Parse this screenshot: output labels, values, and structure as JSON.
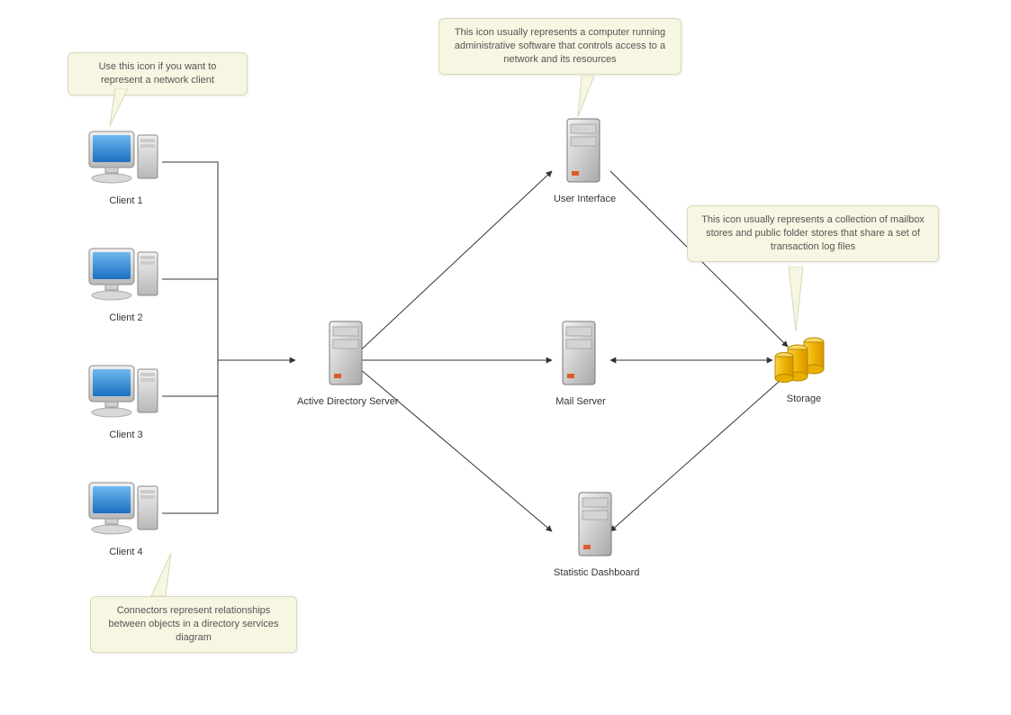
{
  "nodes": {
    "client1": {
      "label": "Client 1"
    },
    "client2": {
      "label": "Client 2"
    },
    "client3": {
      "label": "Client 3"
    },
    "client4": {
      "label": "Client 4"
    },
    "adserver": {
      "label": "Active Directory Server"
    },
    "userinterface": {
      "label": "User Interface"
    },
    "mailserver": {
      "label": "Mail Server"
    },
    "statdash": {
      "label": "Statistic Dashboard"
    },
    "storage": {
      "label": "Storage"
    }
  },
  "callouts": {
    "client_tip": "Use this icon if you want to represent a network client",
    "ui_tip": "This icon usually represents a computer running administrative software that controls access to a network and its resources",
    "storage_tip": "This icon usually represents a collection of mailbox stores and public folder stores that share a set of transaction log files",
    "connector_tip": "Connectors represent relationships between objects in a directory services diagram"
  }
}
